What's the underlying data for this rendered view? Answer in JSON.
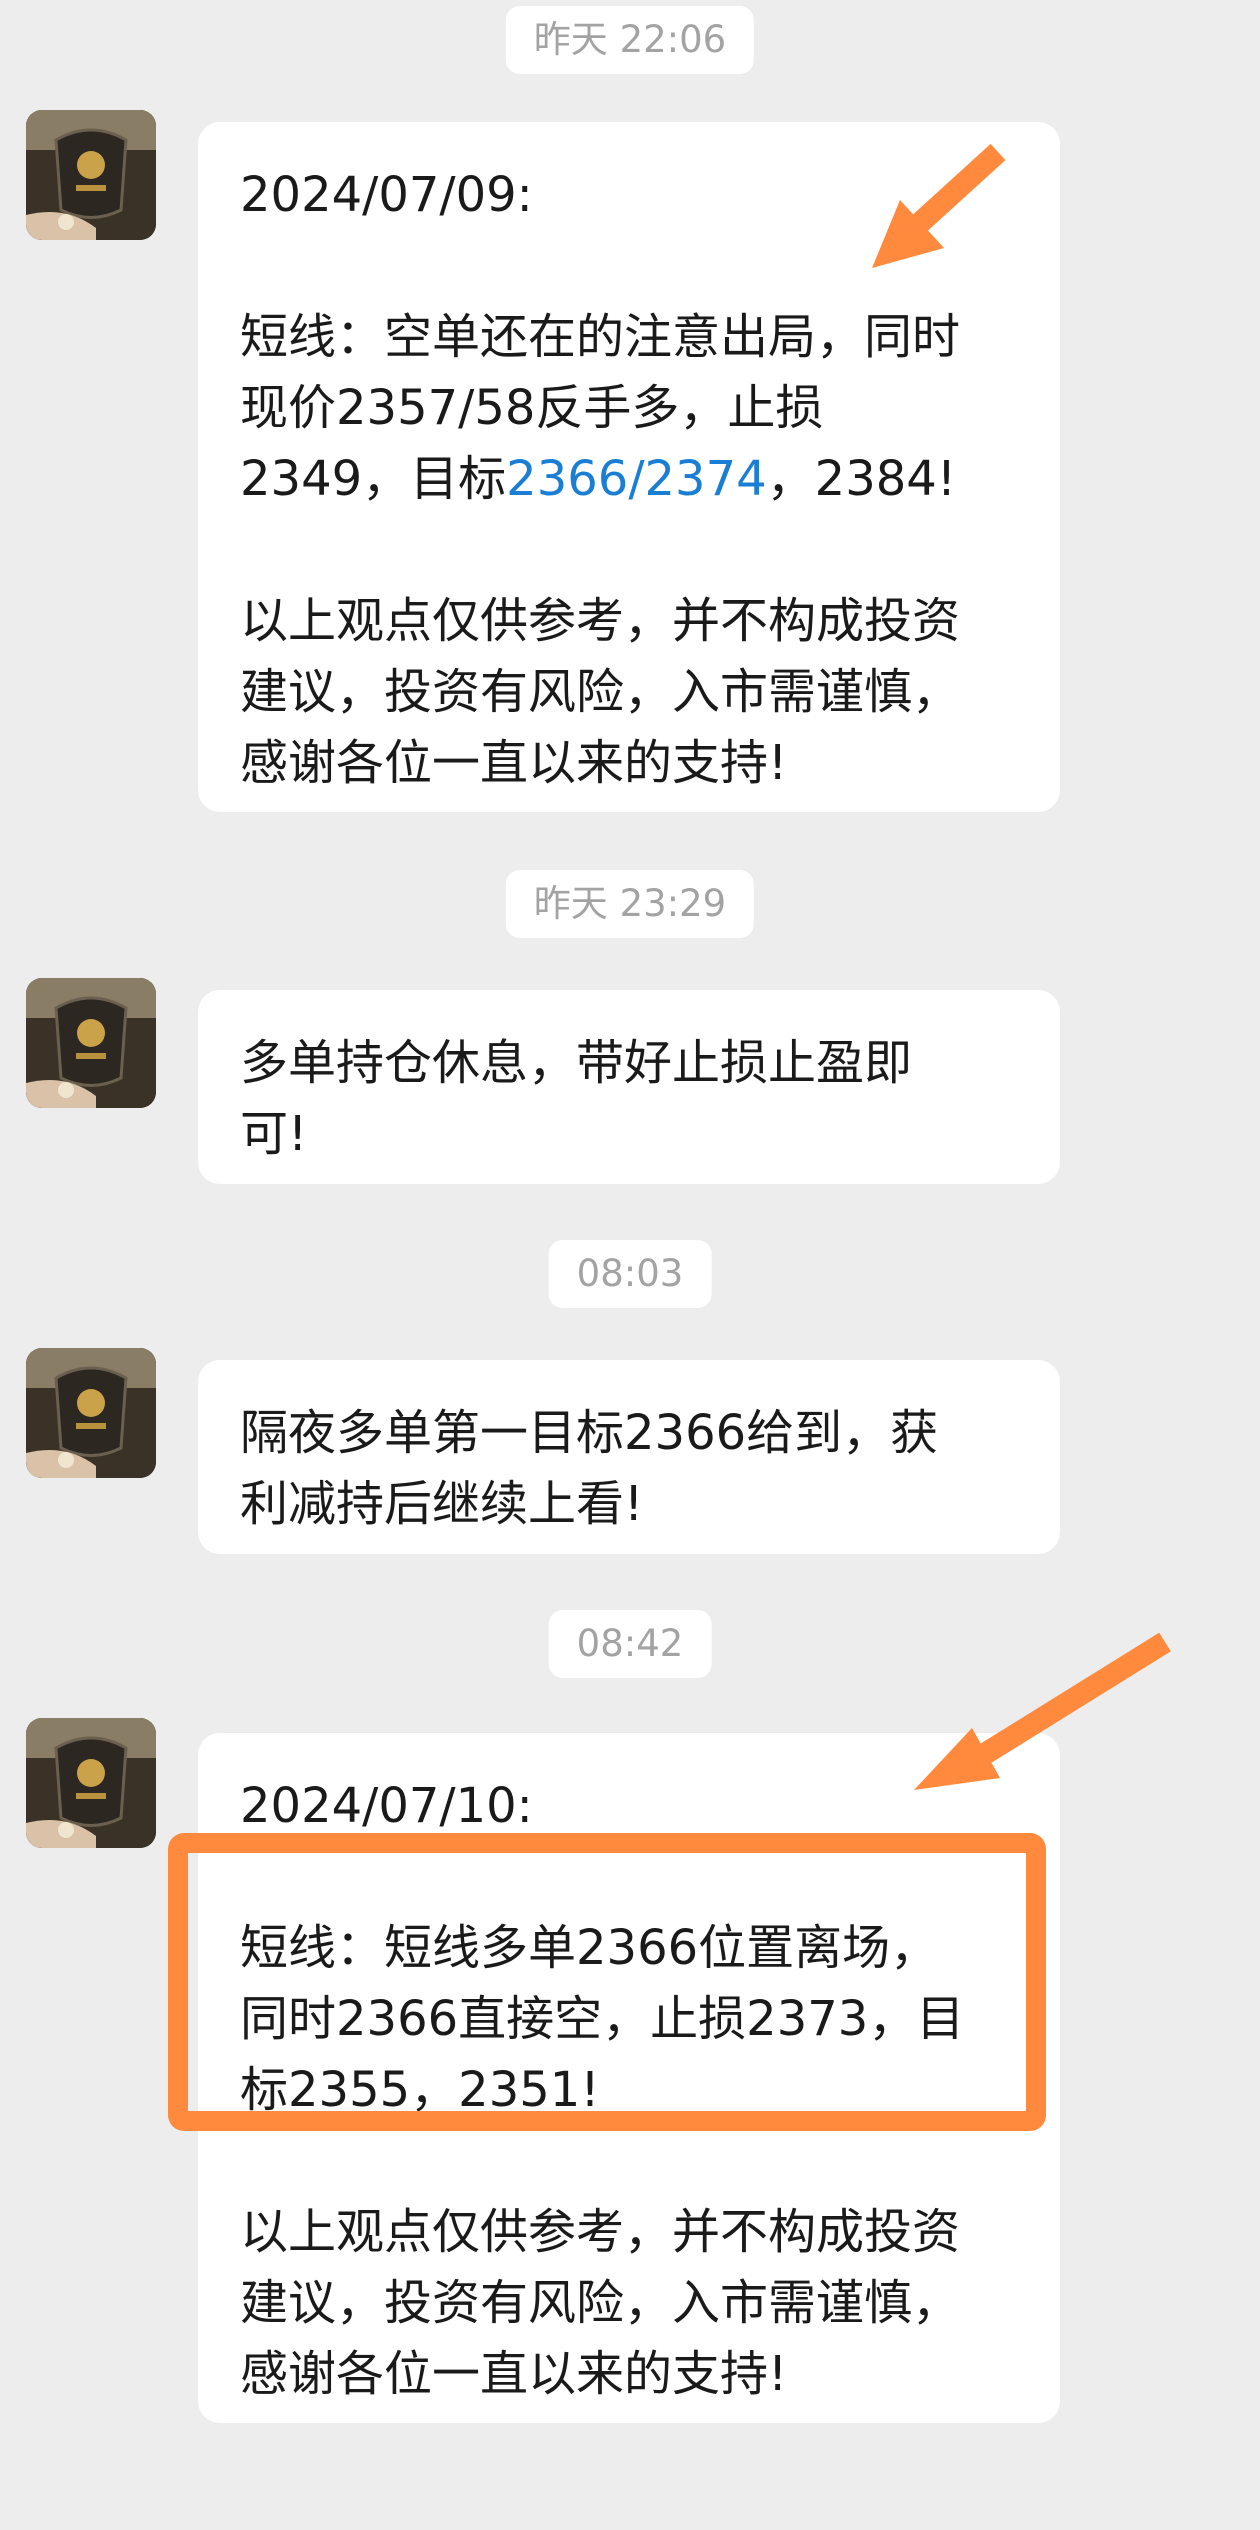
{
  "avatar_icon": "bracelet-photo-avatar",
  "accent_color": "#ff8a3d",
  "link_color": "#1a7fd4",
  "messages": [
    {
      "time": "昨天 22:06",
      "lines": {
        "date": "2024/07/09:",
        "l1": "短线：空单还在的注意出局，同时",
        "l2": "现价2357/58反手多，止损",
        "l3a": "2349，目标",
        "l3link": "2366/2374",
        "l3b": "，2384!",
        "d1": "以上观点仅供参考，并不构成投资",
        "d2": "建议，投资有风险，入市需谨慎，",
        "d3": "感谢各位一直以来的支持!"
      }
    },
    {
      "time": "昨天 23:29",
      "lines": {
        "l1": "多单持仓休息，带好止损止盈即",
        "l2": "可!"
      }
    },
    {
      "time": "08:03",
      "lines": {
        "l1": "隔夜多单第一目标2366给到，获",
        "l2": "利减持后继续上看!"
      }
    },
    {
      "time": "08:42",
      "lines": {
        "date": "2024/07/10:",
        "l1": "短线：短线多单2366位置离场，",
        "l2": "同时2366直接空，止损2373，目",
        "l3": "标2355，2351!",
        "d1": "以上观点仅供参考，并不构成投资",
        "d2": "建议，投资有风险，入市需谨慎，",
        "d3": "感谢各位一直以来的支持!"
      }
    }
  ]
}
